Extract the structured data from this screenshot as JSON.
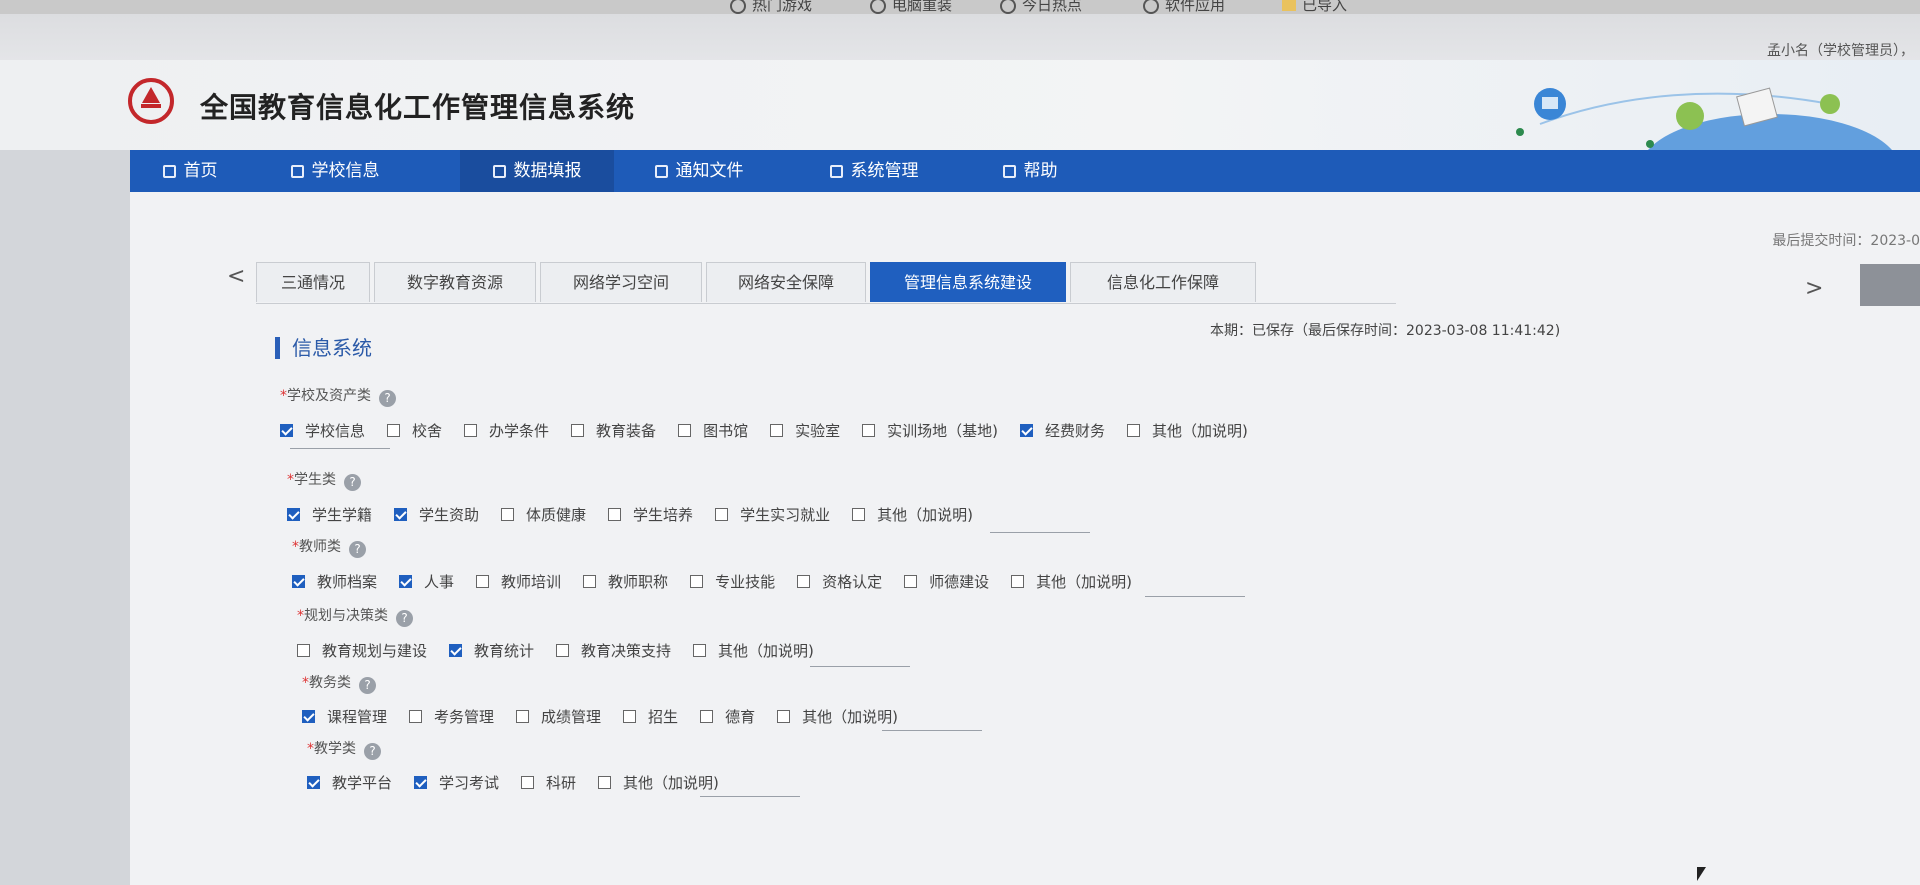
{
  "bookmarks": [
    "热门游戏",
    "电脑重装",
    "今日热点",
    "软件应用",
    "已导入"
  ],
  "user": {
    "label": "孟小名（学校管理员），"
  },
  "site": {
    "title": "全国教育信息化工作管理信息系统"
  },
  "nav": {
    "items": [
      {
        "label": "首页",
        "icon": "home-icon"
      },
      {
        "label": "学校信息",
        "icon": "document-icon"
      },
      {
        "label": "数据填报",
        "icon": "edit-icon"
      },
      {
        "label": "通知文件",
        "icon": "mail-icon"
      },
      {
        "label": "系统管理",
        "icon": "monitor-icon"
      },
      {
        "label": "帮助",
        "icon": "help-grid-icon"
      }
    ],
    "active": "数据填报"
  },
  "submit": {
    "label": "最后提交时间：2023-0"
  },
  "tabs": {
    "items": [
      "三通情况",
      "数字教育资源",
      "网络学习空间",
      "网络安全保障",
      "管理信息系统建设",
      "信息化工作保障"
    ],
    "active": "管理信息系统建设",
    "prev_arrow": "<",
    "next_arrow": ">"
  },
  "section": {
    "title": "信息系统",
    "save_status": "本期：已保存（最后保存时间：2023-03-08 11:41:42)"
  },
  "colors": {
    "primary": "#1e5bb8",
    "active_tab": "#1f5fbf",
    "required": "#dd3333"
  },
  "groups": [
    {
      "label": "学校及资产类",
      "required_mark": "*",
      "help": "?",
      "options": [
        {
          "label": "学校信息",
          "checked": true
        },
        {
          "label": "校舍",
          "checked": false
        },
        {
          "label": "办学条件",
          "checked": false
        },
        {
          "label": "教育装备",
          "checked": false
        },
        {
          "label": "图书馆",
          "checked": false
        },
        {
          "label": "实验室",
          "checked": false
        },
        {
          "label": "实训场地（基地)",
          "checked": false
        },
        {
          "label": "经费财务",
          "checked": true
        },
        {
          "label": "其他（加说明)",
          "checked": false
        }
      ]
    },
    {
      "label": "学生类",
      "required_mark": "*",
      "help": "?",
      "options": [
        {
          "label": "学生学籍",
          "checked": true
        },
        {
          "label": "学生资助",
          "checked": true
        },
        {
          "label": "体质健康",
          "checked": false
        },
        {
          "label": "学生培养",
          "checked": false
        },
        {
          "label": "学生实习就业",
          "checked": false
        },
        {
          "label": "其他（加说明)",
          "checked": false
        }
      ]
    },
    {
      "label": "教师类",
      "required_mark": "*",
      "help": "?",
      "options": [
        {
          "label": "教师档案",
          "checked": true
        },
        {
          "label": "人事",
          "checked": true
        },
        {
          "label": "教师培训",
          "checked": false
        },
        {
          "label": "教师职称",
          "checked": false
        },
        {
          "label": "专业技能",
          "checked": false
        },
        {
          "label": "资格认定",
          "checked": false
        },
        {
          "label": "师德建设",
          "checked": false
        },
        {
          "label": "其他（加说明)",
          "checked": false
        }
      ]
    },
    {
      "label": "规划与决策类",
      "required_mark": "*",
      "help": "?",
      "options": [
        {
          "label": "教育规划与建设",
          "checked": false
        },
        {
          "label": "教育统计",
          "checked": true
        },
        {
          "label": "教育决策支持",
          "checked": false
        },
        {
          "label": "其他（加说明)",
          "checked": false
        }
      ]
    },
    {
      "label": "教务类",
      "required_mark": "*",
      "help": "?",
      "options": [
        {
          "label": "课程管理",
          "checked": true
        },
        {
          "label": "考务管理",
          "checked": false
        },
        {
          "label": "成绩管理",
          "checked": false
        },
        {
          "label": "招生",
          "checked": false
        },
        {
          "label": "德育",
          "checked": false
        },
        {
          "label": "其他（加说明)",
          "checked": false
        }
      ]
    },
    {
      "label": "教学类",
      "required_mark": "*",
      "help": "?",
      "options": [
        {
          "label": "教学平台",
          "checked": true
        },
        {
          "label": "学习考试",
          "checked": true
        },
        {
          "label": "科研",
          "checked": false
        },
        {
          "label": "其他（加说明)",
          "checked": false
        }
      ]
    }
  ]
}
